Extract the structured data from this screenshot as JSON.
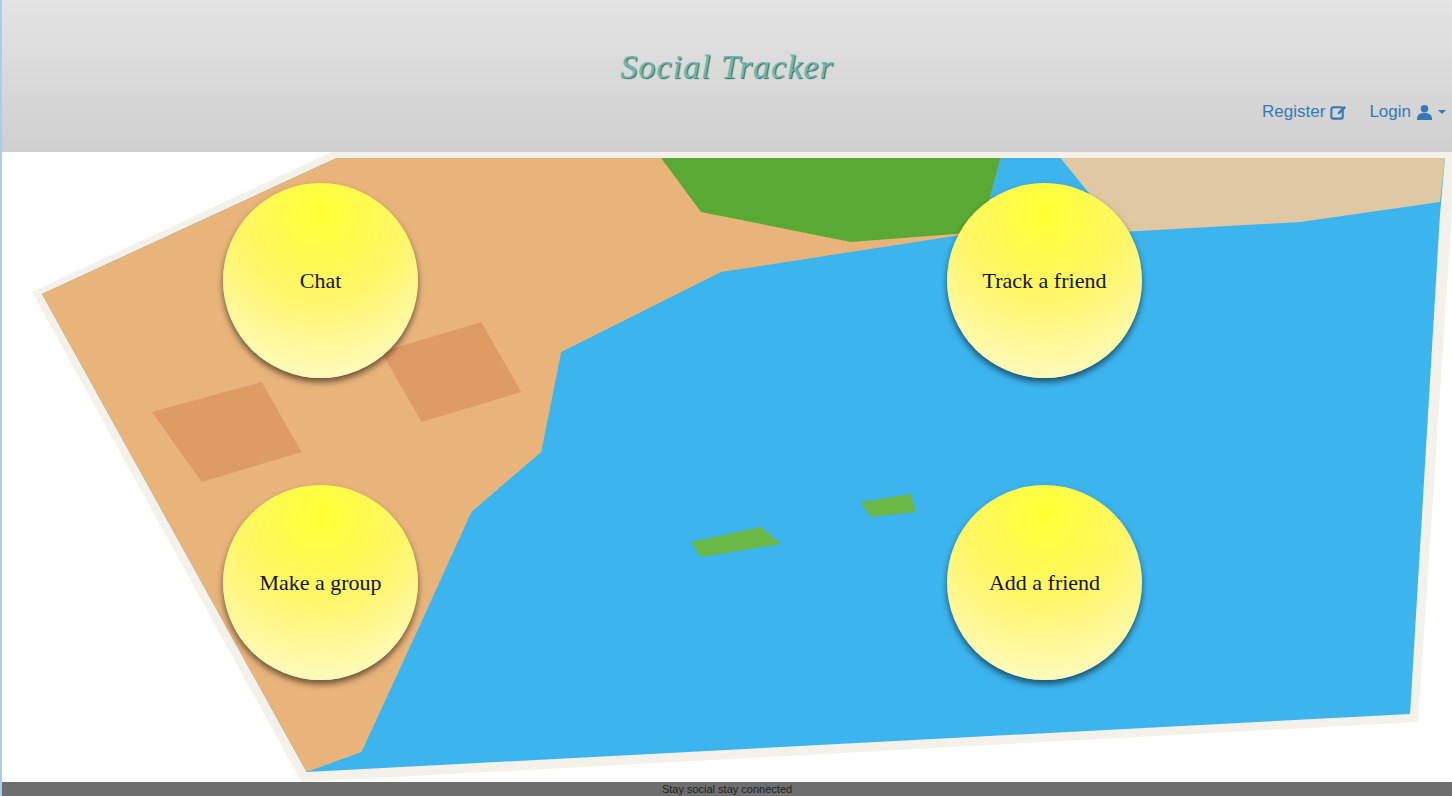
{
  "header": {
    "title": "Social Tracker",
    "nav": [
      {
        "label": "Register",
        "kind": "register"
      },
      {
        "label": "Login",
        "kind": "login"
      }
    ]
  },
  "actions": [
    "Chat",
    "Track a friend",
    "Make a group",
    "Add a friend"
  ],
  "footer": {
    "text": "Stay social stay connected"
  }
}
